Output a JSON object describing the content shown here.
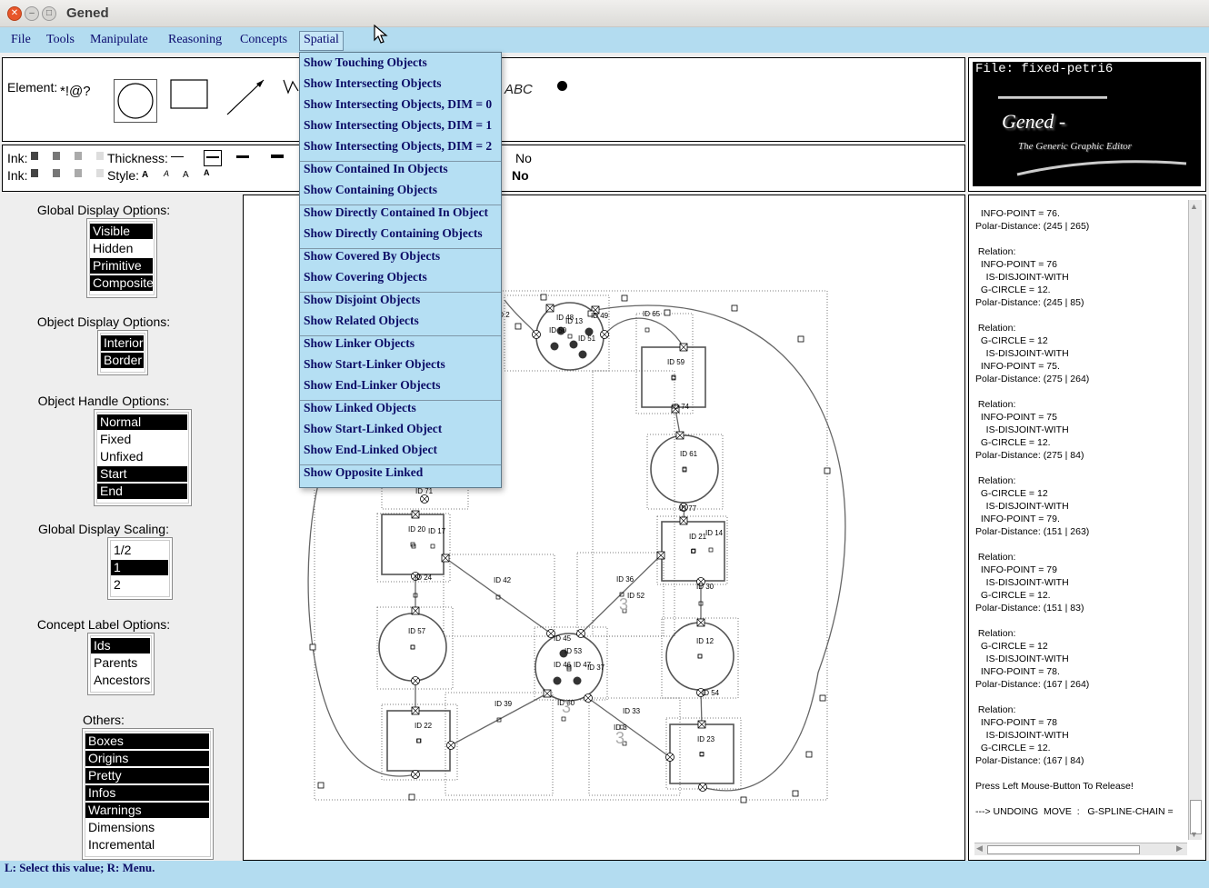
{
  "window": {
    "title": "Gened"
  },
  "menubar": [
    "File",
    "Tools",
    "Manipulate",
    "Reasoning",
    "Concepts",
    "Spatial"
  ],
  "spatial_menu": {
    "groups": [
      [
        "Show Touching Objects",
        "Show Intersecting Objects",
        "Show Intersecting Objects, DIM = 0",
        "Show Intersecting Objects, DIM = 1",
        "Show Intersecting Objects, DIM = 2"
      ],
      [
        "Show Contained In Objects",
        "Show Containing Objects"
      ],
      [
        "Show Directly Contained In Object",
        "Show Directly Containing Objects"
      ],
      [
        "Show Covered By Objects",
        "Show Covering Objects"
      ],
      [
        "Show Disjoint Objects",
        "Show Related Objects"
      ],
      [
        "Show Linker Objects",
        "Show Start-Linker Objects",
        "Show End-Linker Objects"
      ],
      [
        "Show Linked Objects",
        "Show Start-Linked Object",
        "Show End-Linked Object"
      ],
      [
        "Show Opposite Linked"
      ]
    ]
  },
  "toolbar": {
    "element_label": "Element:",
    "element_symbols": "*!@?",
    "text_tool": "ABC",
    "ink_label": "Ink:",
    "thickness_label": "Thickness:",
    "style_label": "Style:",
    "style_glyph": "A",
    "no_label": "No"
  },
  "file_panel": {
    "file_label": "File: fixed-petri6",
    "logo": "Gened -",
    "subtitle": "The Generic Graphic Editor"
  },
  "options": {
    "global_display": {
      "title": "Global Display Options:",
      "items": [
        {
          "label": "Visible",
          "sel": true
        },
        {
          "label": "Hidden",
          "sel": false
        },
        {
          "label": "Primitive",
          "sel": true
        },
        {
          "label": "Composite",
          "sel": true
        }
      ]
    },
    "object_display": {
      "title": "Object Display Options:",
      "items": [
        {
          "label": "Interior",
          "sel": true
        },
        {
          "label": "Border",
          "sel": true
        }
      ]
    },
    "object_handle": {
      "title": "Object Handle Options:",
      "items": [
        {
          "label": "Normal",
          "sel": true
        },
        {
          "label": "Fixed",
          "sel": false
        },
        {
          "label": "Unfixed",
          "sel": false
        },
        {
          "label": "Start",
          "sel": true
        },
        {
          "label": "End",
          "sel": true
        }
      ]
    },
    "global_scaling": {
      "title": "Global Display Scaling:",
      "items": [
        {
          "label": "1/2",
          "sel": false
        },
        {
          "label": "1",
          "sel": true
        },
        {
          "label": "2",
          "sel": false
        }
      ]
    },
    "concept_label": {
      "title": "Concept Label Options:",
      "items": [
        {
          "label": "Ids",
          "sel": true
        },
        {
          "label": "Parents",
          "sel": false
        },
        {
          "label": "Ancestors",
          "sel": false
        }
      ]
    },
    "others": {
      "title": "Others:",
      "items": [
        {
          "label": "Boxes",
          "sel": true
        },
        {
          "label": "Origins",
          "sel": true
        },
        {
          "label": "Pretty",
          "sel": true
        },
        {
          "label": "Infos",
          "sel": true
        },
        {
          "label": "Warnings",
          "sel": true
        },
        {
          "label": "Dimensions",
          "sel": false
        },
        {
          "label": "Incremental",
          "sel": false
        }
      ]
    }
  },
  "log_lines": [
    "  INFO-POINT = 76.",
    "Polar-Distance: (245 | 265)",
    "",
    " Relation:",
    "  INFO-POINT = 76",
    "    IS-DISJOINT-WITH",
    "  G-CIRCLE = 12.",
    "Polar-Distance: (245 | 85)",
    "",
    " Relation:",
    "  G-CIRCLE = 12",
    "    IS-DISJOINT-WITH",
    "  INFO-POINT = 75.",
    "Polar-Distance: (275 | 264)",
    "",
    " Relation:",
    "  INFO-POINT = 75",
    "    IS-DISJOINT-WITH",
    "  G-CIRCLE = 12.",
    "Polar-Distance: (275 | 84)",
    "",
    " Relation:",
    "  G-CIRCLE = 12",
    "    IS-DISJOINT-WITH",
    "  INFO-POINT = 79.",
    "Polar-Distance: (151 | 263)",
    "",
    " Relation:",
    "  INFO-POINT = 79",
    "    IS-DISJOINT-WITH",
    "  G-CIRCLE = 12.",
    "Polar-Distance: (151 | 83)",
    "",
    " Relation:",
    "  G-CIRCLE = 12",
    "    IS-DISJOINT-WITH",
    "  INFO-POINT = 78.",
    "Polar-Distance: (167 | 264)",
    "",
    " Relation:",
    "  INFO-POINT = 78",
    "    IS-DISJOINT-WITH",
    "  G-CIRCLE = 12.",
    "Polar-Distance: (167 | 84)",
    "",
    "Press Left Mouse-Button To Release!",
    "",
    "---> UNDOING  MOVE  :   G-SPLINE-CHAIN ="
  ],
  "diagram": {
    "labels": [
      "ID 2",
      "ID 48",
      "ID 13",
      "ID 49",
      "ID 50",
      "ID 51",
      "ID 65",
      "ID 59",
      "ID 74",
      "ID 61",
      "ID 77",
      "ID 71",
      "ID 20",
      "ID 17",
      "ID 21",
      "ID 14",
      "ID 42",
      "ID 36",
      "ID 52",
      "ID 24",
      "ID 30",
      "ID 57",
      "ID 46",
      "ID 53",
      "ID 45",
      "ID 47",
      "ID 12",
      "ID 37",
      "ID 54",
      "ID 39",
      "ID 60",
      "ID 33",
      "ID 22",
      "ID 23",
      "ID 3"
    ],
    "big_numbers": [
      "3",
      "3",
      "3"
    ]
  },
  "status": "L: Select this value; R: Menu."
}
